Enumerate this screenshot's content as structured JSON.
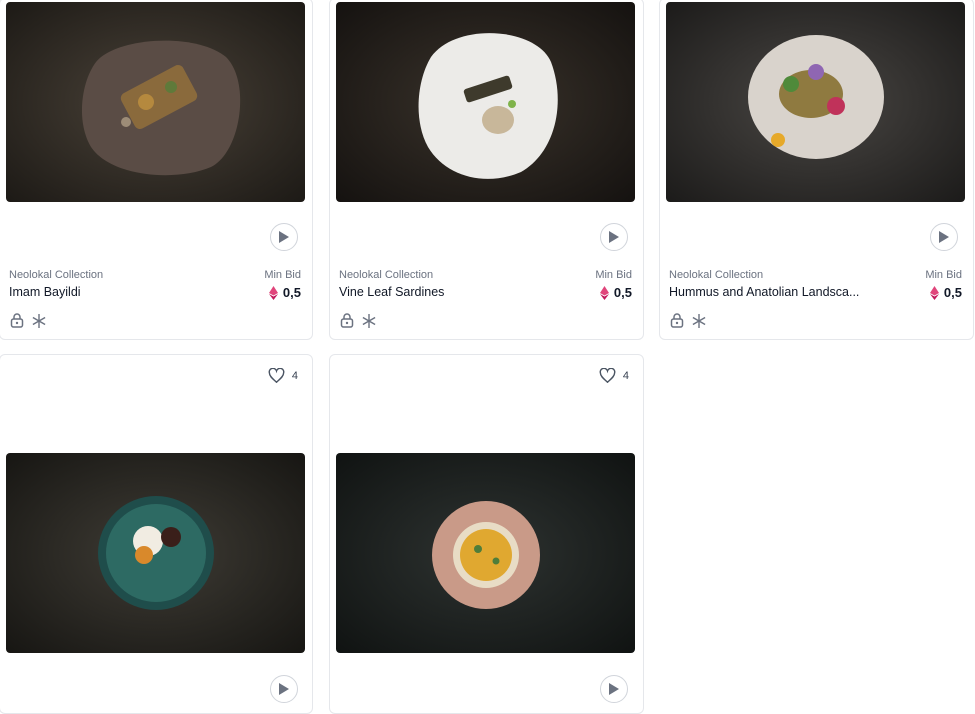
{
  "cards": [
    {
      "collection": "Neolokal Collection",
      "title": "Imam Bayildi",
      "minbid_label": "Min Bid",
      "price": "0,5"
    },
    {
      "collection": "Neolokal Collection",
      "title": "Vine Leaf Sardines",
      "minbid_label": "Min Bid",
      "price": "0,5"
    },
    {
      "collection": "Neolokal Collection",
      "title": "Hummus and Anatolian Landsca...",
      "minbid_label": "Min Bid",
      "price": "0,5"
    },
    {
      "likes": "4"
    },
    {
      "likes": "4"
    }
  ],
  "icons": {
    "play": "play-icon",
    "eth": "ethereum-icon",
    "lock": "lock-icon",
    "snow": "snowflake-icon",
    "heart": "heart-icon"
  },
  "colors": {
    "eth": "#e0457b",
    "border": "#e5e7eb"
  }
}
